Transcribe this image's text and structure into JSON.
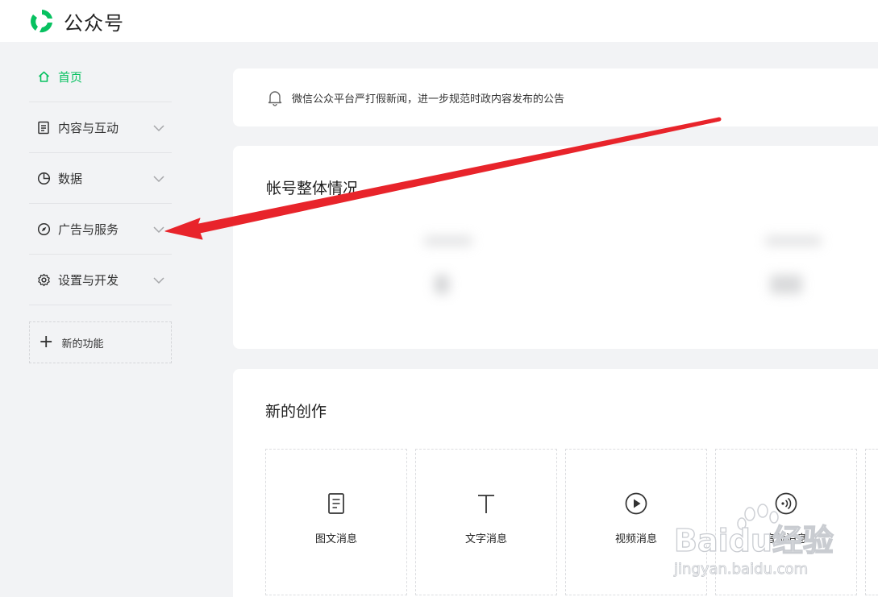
{
  "header": {
    "brand": "公众号",
    "logo_icon": "wechat-official-account-logo",
    "accent_color": "#07c160"
  },
  "sidebar": {
    "items": [
      {
        "label": "首页",
        "icon": "home-icon",
        "active": true
      },
      {
        "label": "内容与互动",
        "icon": "document-icon",
        "expandable": true
      },
      {
        "label": "数据",
        "icon": "pie-chart-icon",
        "expandable": true
      },
      {
        "label": "广告与服务",
        "icon": "compass-icon",
        "expandable": true
      },
      {
        "label": "设置与开发",
        "icon": "gear-icon",
        "expandable": true
      }
    ],
    "new_feature": {
      "label": "新的功能",
      "icon": "plus-icon"
    }
  },
  "notice": {
    "icon": "bell-icon",
    "text": "微信公众平台严打假新闻，进一步规范时政内容发布的公告"
  },
  "overview": {
    "title": "帐号整体情况"
  },
  "create": {
    "title": "新的创作",
    "cards": [
      {
        "label": "图文消息",
        "icon": "article-icon"
      },
      {
        "label": "文字消息",
        "icon": "text-icon"
      },
      {
        "label": "视频消息",
        "icon": "play-icon"
      },
      {
        "label": "音频消息",
        "icon": "audio-icon"
      }
    ]
  },
  "annotation": {
    "arrow_color": "#e8242b"
  },
  "watermark": {
    "brand": "Baidu经验",
    "url": "jingyan.baidu.com"
  }
}
